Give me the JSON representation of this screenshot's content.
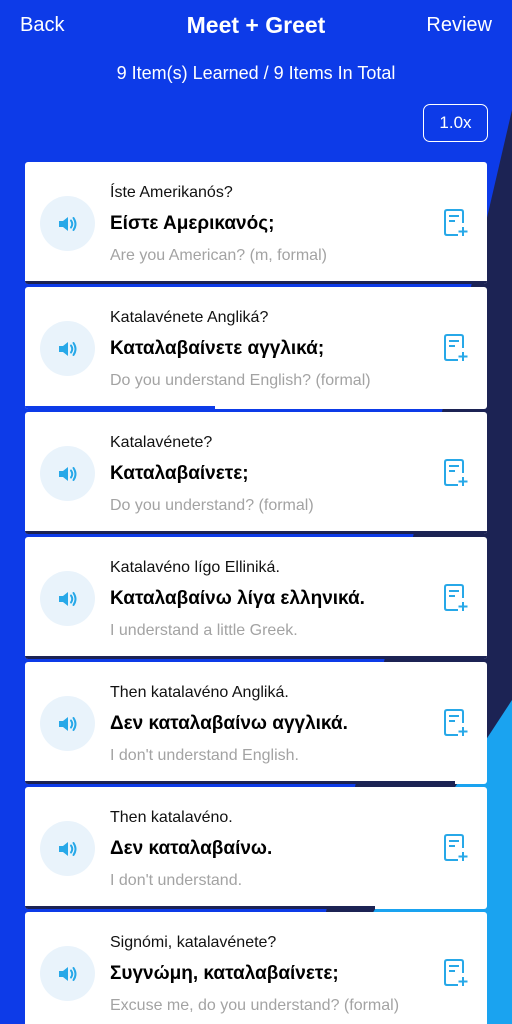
{
  "header": {
    "back_label": "Back",
    "title": "Meet + Greet",
    "review_label": "Review"
  },
  "progress_text": "9 Item(s) Learned / 9 Items In Total",
  "speed_label": "1.0x",
  "colors": {
    "background": "#0d3be8",
    "dark_band": "#1c2354",
    "accent_cyan": "#1aa3f0",
    "icon_blue": "#27a8e8",
    "speaker_bg": "#e9f3fb",
    "secondary_text": "#a3a3a3"
  },
  "items": [
    {
      "translit": "Íste Amerikanós?",
      "greek": "Είστε Αμερικανός;",
      "english": "Are you American? (m, formal)",
      "speaker_icon": "speaker-icon",
      "note_icon": "add-note-icon"
    },
    {
      "translit": "Katalavénete Angliká?",
      "greek": "Καταλαβαίνετε αγγλικά;",
      "english": "Do you understand English? (formal)",
      "speaker_icon": "speaker-icon",
      "note_icon": "add-note-icon"
    },
    {
      "translit": "Katalavénete?",
      "greek": "Καταλαβαίνετε;",
      "english": "Do you understand? (formal)",
      "speaker_icon": "speaker-icon",
      "note_icon": "add-note-icon"
    },
    {
      "translit": "Katalavéno lígo Elliniká.",
      "greek": "Καταλαβαίνω λίγα ελληνικά.",
      "english": "I understand a little Greek.",
      "speaker_icon": "speaker-icon",
      "note_icon": "add-note-icon"
    },
    {
      "translit": "Then katalavéno Angliká.",
      "greek": "Δεν καταλαβαίνω αγγλικά.",
      "english": "I don't understand English.",
      "speaker_icon": "speaker-icon",
      "note_icon": "add-note-icon"
    },
    {
      "translit": "Then katalavéno.",
      "greek": "Δεν καταλαβαίνω.",
      "english": "I don't understand.",
      "speaker_icon": "speaker-icon",
      "note_icon": "add-note-icon"
    },
    {
      "translit": "Signómi, katalavénete?",
      "greek": "Συγνώμη, καταλαβαίνετε;",
      "english": "Excuse me, do you understand? (formal)",
      "speaker_icon": "speaker-icon",
      "note_icon": "add-note-icon"
    }
  ]
}
